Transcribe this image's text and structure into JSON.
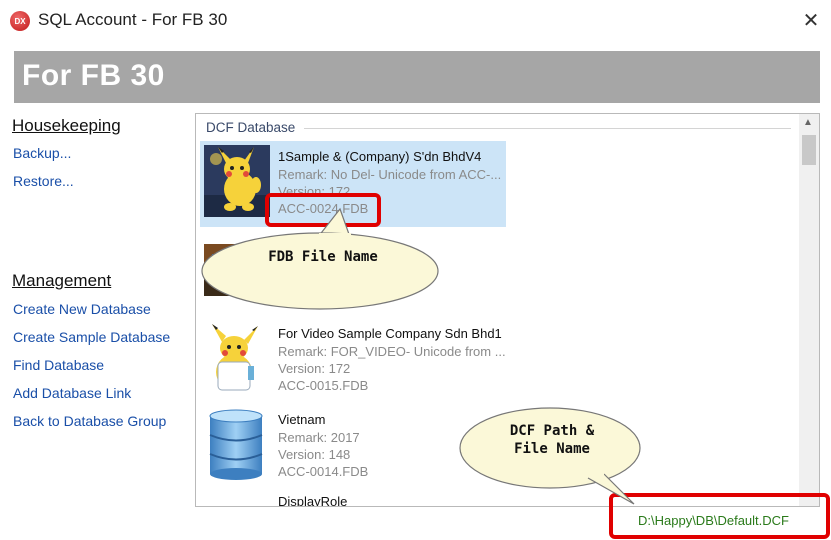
{
  "window": {
    "title": "SQL Account - For FB 30",
    "app_icon_text": "DX",
    "close_glyph": "✕"
  },
  "header": {
    "title": "For FB 30"
  },
  "left_menu": {
    "housekeeping": {
      "heading": "Housekeeping",
      "items": [
        {
          "label": "Backup..."
        },
        {
          "label": "Restore..."
        }
      ]
    },
    "management": {
      "heading": "Management",
      "items": [
        {
          "label": "Create New Database"
        },
        {
          "label": "Create Sample Database"
        },
        {
          "label": "Find Database"
        },
        {
          "label": "Add Database Link"
        },
        {
          "label": "Back to Database Group"
        }
      ]
    }
  },
  "dcf_panel": {
    "caption": "DCF Database",
    "databases": [
      {
        "name": "1Sample & (Company) S'dn BhdV4",
        "remark": "Remark: No Del- Unicode from ACC-...",
        "version": "Version: 172",
        "file": "ACC-0024.FDB",
        "selected": true,
        "thumbnail": "pikachu-dance-image"
      },
      {
        "name": "",
        "remark": "",
        "version": "",
        "file": "",
        "selected": false,
        "thumbnail": "pikachu-image"
      },
      {
        "name": "For Video Sample Company Sdn Bhd1",
        "remark": "Remark: FOR_VIDEO- Unicode from ...",
        "version": "Version: 172",
        "file": "ACC-0015.FDB",
        "selected": false,
        "thumbnail": "pikachu-scientist-image"
      },
      {
        "name": "Vietnam",
        "remark": "Remark: 2017",
        "version": "Version: 148",
        "file": "ACC-0014.FDB",
        "selected": false,
        "thumbnail": "database-cylinder-icon"
      },
      {
        "name": "DisplayRole",
        "remark": "",
        "version": "",
        "file": "",
        "selected": false,
        "thumbnail": ""
      }
    ]
  },
  "status": {
    "dcf_path": "D:\\Happy\\DB\\Default.DCF"
  },
  "annotations": {
    "fdb_callout": "FDB File Name",
    "dcf_callout_line1": "DCF Path &",
    "dcf_callout_line2": "File Name",
    "highlight_color": "#e00000",
    "callout_fill": "#fbf8d8"
  }
}
